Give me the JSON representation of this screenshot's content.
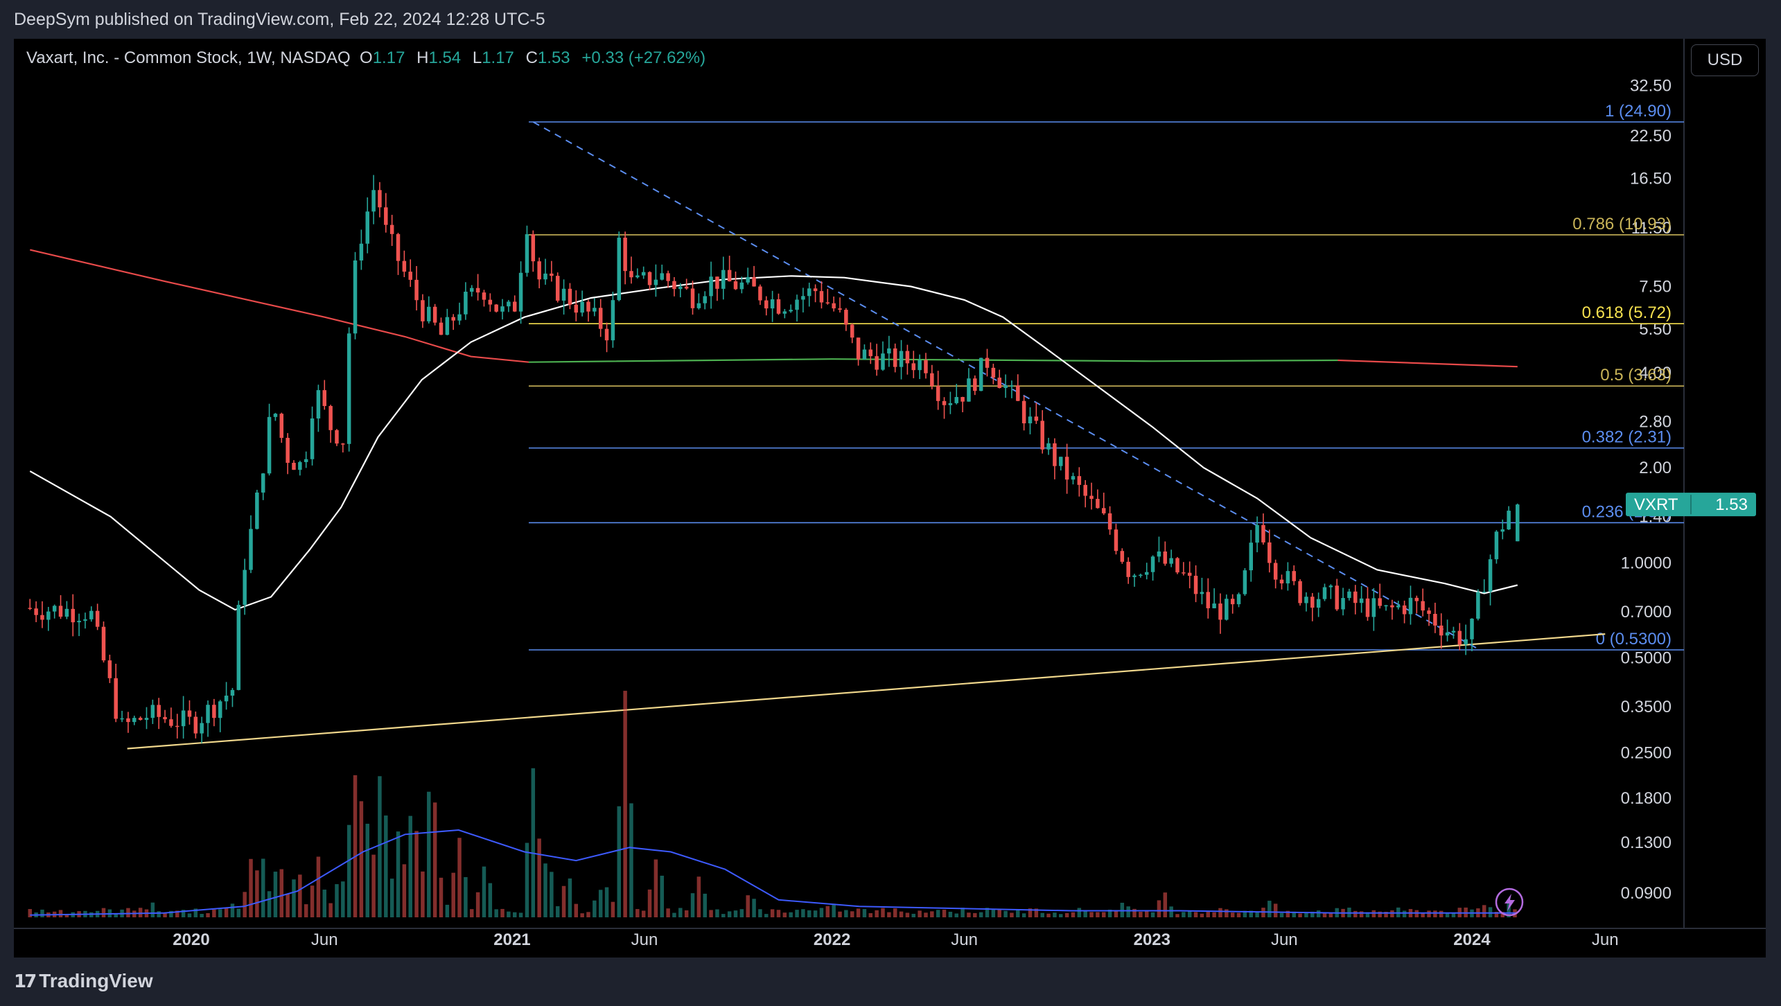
{
  "header": {
    "published": "DeepSym published on TradingView.com, Feb 22, 2024 12:28 UTC-5"
  },
  "legend": {
    "symbol_desc": "Vaxart, Inc. - Common Stock, 1W, NASDAQ",
    "o_label": "O",
    "o_value": "1.17",
    "h_label": "H",
    "h_value": "1.54",
    "l_label": "L",
    "l_value": "1.17",
    "c_label": "C",
    "c_value": "1.53",
    "change": "+0.33 (+27.62%)"
  },
  "currency_button": "USD",
  "brand": "TradingView",
  "price_tag": {
    "symbol": "VXRT",
    "price": "1.53"
  },
  "colors": {
    "up": "#26a69a",
    "down": "#ef5350",
    "fib_blue": "#5b8def",
    "fib_gold": "#c9b458",
    "fib_yellow": "#f5e04e",
    "trend": "#f0d78c",
    "ma_white": "#ffffff",
    "ma_red": "#e84a4a",
    "ma_green": "#4caf50",
    "vol_ma": "#3d5afe"
  },
  "chart_data": {
    "type": "candlestick",
    "title": "Vaxart, Inc. - Common Stock, 1W, NASDAQ",
    "y_scale": "log",
    "y_ticks": [
      "32.50",
      "22.50",
      "16.50",
      "11.50",
      "7.50",
      "5.50",
      "4.00",
      "2.80",
      "2.00",
      "1.40",
      "1.0000",
      "0.7000",
      "0.5000",
      "0.3500",
      "0.2500",
      "0.1800",
      "0.1300",
      "0.0900"
    ],
    "x_ticks": [
      {
        "label": "2020",
        "bold": true,
        "date": "2020-01-01"
      },
      {
        "label": "Jun",
        "bold": false,
        "date": "2020-06-01"
      },
      {
        "label": "2021",
        "bold": true,
        "date": "2021-01-01"
      },
      {
        "label": "Jun",
        "bold": false,
        "date": "2021-06-01"
      },
      {
        "label": "2022",
        "bold": true,
        "date": "2022-01-01"
      },
      {
        "label": "Jun",
        "bold": false,
        "date": "2022-06-01"
      },
      {
        "label": "2023",
        "bold": true,
        "date": "2023-01-01"
      },
      {
        "label": "Jun",
        "bold": false,
        "date": "2023-06-01"
      },
      {
        "label": "2024",
        "bold": true,
        "date": "2024-01-01"
      },
      {
        "label": "Jun",
        "bold": false,
        "date": "2024-06-01"
      }
    ],
    "fib_levels": [
      {
        "label": "1 (24.90)",
        "price": 24.9,
        "color": "fib_blue"
      },
      {
        "label": "0.786 (10.93)",
        "price": 10.93,
        "color": "fib_gold"
      },
      {
        "label": "0.618 (5.72)",
        "price": 5.72,
        "color": "fib_yellow"
      },
      {
        "label": "0.5 (3.63)",
        "price": 3.63,
        "color": "fib_gold"
      },
      {
        "label": "0.382 (2.31)",
        "price": 2.31,
        "color": "fib_blue"
      },
      {
        "label": "0.236 (1.34)",
        "price": 1.34,
        "color": "fib_blue"
      },
      {
        "label": "0 (0.5300)",
        "price": 0.53,
        "color": "fib_blue"
      }
    ],
    "price_path": [
      [
        "2019-07-01",
        0.72
      ],
      [
        "2019-09-15",
        0.7
      ],
      [
        "2019-10-20",
        0.3
      ],
      [
        "2019-11-20",
        0.33
      ],
      [
        "2020-01-10",
        0.31
      ],
      [
        "2020-02-25",
        0.4
      ],
      [
        "2020-03-05",
        0.9
      ],
      [
        "2020-03-20",
        1.4
      ],
      [
        "2020-04-10",
        3.2
      ],
      [
        "2020-04-25",
        2.2
      ],
      [
        "2020-05-15",
        2.0
      ],
      [
        "2020-05-28",
        3.6
      ],
      [
        "2020-06-15",
        2.7
      ],
      [
        "2020-06-30",
        2.45
      ],
      [
        "2020-07-08",
        7.0
      ],
      [
        "2020-07-20",
        11.0
      ],
      [
        "2020-08-05",
        16.0
      ],
      [
        "2020-08-15",
        11.5
      ],
      [
        "2020-09-05",
        8.5
      ],
      [
        "2020-09-25",
        6.5
      ],
      [
        "2020-10-20",
        5.2
      ],
      [
        "2020-11-10",
        6.5
      ],
      [
        "2020-12-05",
        7.5
      ],
      [
        "2020-12-25",
        6.2
      ],
      [
        "2021-01-10",
        6.3
      ],
      [
        "2021-01-25",
        12.0
      ],
      [
        "2021-02-05",
        8.0
      ],
      [
        "2021-03-05",
        7.2
      ],
      [
        "2021-04-10",
        6.0
      ],
      [
        "2021-04-30",
        5.3
      ],
      [
        "2021-05-10",
        10.5
      ],
      [
        "2021-05-25",
        7.5
      ],
      [
        "2021-06-25",
        8.2
      ],
      [
        "2021-08-01",
        7.0
      ],
      [
        "2021-08-25",
        7.9
      ],
      [
        "2021-10-01",
        7.5
      ],
      [
        "2021-11-10",
        6.6
      ],
      [
        "2021-12-20",
        7.3
      ],
      [
        "2022-01-15",
        6.2
      ],
      [
        "2022-02-05",
        4.6
      ],
      [
        "2022-03-15",
        4.4
      ],
      [
        "2022-04-25",
        4.3
      ],
      [
        "2022-05-15",
        3.3
      ],
      [
        "2022-06-10",
        3.5
      ],
      [
        "2022-07-05",
        4.4
      ],
      [
        "2022-07-25",
        3.6
      ],
      [
        "2022-08-25",
        2.7
      ],
      [
        "2022-09-20",
        2.1
      ],
      [
        "2022-10-25",
        1.6
      ],
      [
        "2022-11-20",
        1.3
      ],
      [
        "2022-12-15",
        0.92
      ],
      [
        "2023-01-10",
        1.05
      ],
      [
        "2023-02-15",
        0.9
      ],
      [
        "2023-03-15",
        0.72
      ],
      [
        "2023-04-15",
        0.7
      ],
      [
        "2023-05-10",
        1.4
      ],
      [
        "2023-05-25",
        1.0
      ],
      [
        "2023-06-25",
        0.8
      ],
      [
        "2023-08-01",
        0.78
      ],
      [
        "2023-09-01",
        0.74
      ],
      [
        "2023-10-01",
        0.7
      ],
      [
        "2023-11-01",
        0.75
      ],
      [
        "2023-12-15",
        0.6
      ],
      [
        "2024-01-05",
        0.57
      ],
      [
        "2024-01-20",
        0.85
      ],
      [
        "2024-02-05",
        1.2
      ],
      [
        "2024-02-22",
        1.53
      ]
    ],
    "ma_white": [
      [
        "2019-07-01",
        1.95
      ],
      [
        "2019-10-01",
        1.4
      ],
      [
        "2020-01-10",
        0.82
      ],
      [
        "2020-02-20",
        0.71
      ],
      [
        "2020-04-01",
        0.78
      ],
      [
        "2020-05-15",
        1.1
      ],
      [
        "2020-06-20",
        1.5
      ],
      [
        "2020-08-01",
        2.5
      ],
      [
        "2020-09-20",
        3.8
      ],
      [
        "2020-11-15",
        5.0
      ],
      [
        "2021-01-15",
        6.0
      ],
      [
        "2021-04-01",
        6.9
      ],
      [
        "2021-06-15",
        7.4
      ],
      [
        "2021-09-01",
        7.9
      ],
      [
        "2021-11-15",
        8.1
      ],
      [
        "2022-01-15",
        8.0
      ],
      [
        "2022-04-01",
        7.5
      ],
      [
        "2022-06-01",
        6.8
      ],
      [
        "2022-07-15",
        6.0
      ],
      [
        "2022-09-01",
        4.8
      ],
      [
        "2022-11-01",
        3.6
      ],
      [
        "2023-01-01",
        2.7
      ],
      [
        "2023-03-01",
        2.0
      ],
      [
        "2023-05-01",
        1.6
      ],
      [
        "2023-07-01",
        1.2
      ],
      [
        "2023-09-15",
        0.95
      ],
      [
        "2023-12-01",
        0.86
      ],
      [
        "2024-01-15",
        0.8
      ],
      [
        "2024-02-22",
        0.85
      ]
    ],
    "ma_red": [
      [
        "2019-07-01",
        9.8
      ],
      [
        "2019-12-01",
        7.8
      ],
      [
        "2020-06-01",
        6.0
      ],
      [
        "2020-09-01",
        5.2
      ],
      [
        "2020-11-15",
        4.5
      ],
      [
        "2021-01-20",
        4.32
      ]
    ],
    "ma_green": [
      [
        "2021-01-20",
        4.32
      ],
      [
        "2022-01-01",
        4.42
      ],
      [
        "2023-01-01",
        4.35
      ],
      [
        "2023-08-01",
        4.38
      ]
    ],
    "ma_red_2": [
      [
        "2023-08-01",
        4.38
      ],
      [
        "2024-02-22",
        4.18
      ]
    ],
    "trendline_solid": [
      [
        "2019-10-20",
        0.258
      ],
      [
        "2024-06-01",
        0.595
      ]
    ],
    "trendline_dashed": [
      [
        "2021-01-25",
        24.9
      ],
      [
        "2024-01-10",
        0.53
      ]
    ],
    "volume_bars": [
      [
        "2019-11-15",
        4
      ],
      [
        "2020-02-15",
        3
      ],
      [
        "2020-03-10",
        25
      ],
      [
        "2020-03-20",
        30
      ],
      [
        "2020-04-10",
        28
      ],
      [
        "2020-05-01",
        20
      ],
      [
        "2020-05-25",
        25
      ],
      [
        "2020-06-20",
        18
      ],
      [
        "2020-07-05",
        70
      ],
      [
        "2020-07-15",
        62
      ],
      [
        "2020-08-05",
        72
      ],
      [
        "2020-08-25",
        40
      ],
      [
        "2020-09-10",
        55
      ],
      [
        "2020-10-01",
        72
      ],
      [
        "2020-11-01",
        35
      ],
      [
        "2020-12-01",
        22
      ],
      [
        "2021-01-25",
        65
      ],
      [
        "2021-02-10",
        28
      ],
      [
        "2021-03-05",
        20
      ],
      [
        "2021-04-15",
        15
      ],
      [
        "2021-05-10",
        100
      ],
      [
        "2021-06-15",
        28
      ],
      [
        "2021-08-01",
        18
      ],
      [
        "2021-10-01",
        9
      ],
      [
        "2022-01-01",
        4
      ],
      [
        "2022-06-01",
        3
      ],
      [
        "2022-12-01",
        5
      ],
      [
        "2023-01-15",
        8
      ],
      [
        "2023-05-15",
        6
      ],
      [
        "2024-01-20",
        5
      ],
      [
        "2024-02-15",
        5
      ]
    ],
    "volume_ma": [
      [
        "2019-07-01",
        1
      ],
      [
        "2019-12-01",
        2
      ],
      [
        "2020-03-01",
        5
      ],
      [
        "2020-05-01",
        12
      ],
      [
        "2020-07-15",
        30
      ],
      [
        "2020-09-01",
        38
      ],
      [
        "2020-11-01",
        40
      ],
      [
        "2021-01-15",
        30
      ],
      [
        "2021-03-15",
        26
      ],
      [
        "2021-05-15",
        32
      ],
      [
        "2021-07-01",
        30
      ],
      [
        "2021-09-01",
        22
      ],
      [
        "2021-11-01",
        8
      ],
      [
        "2022-02-01",
        5
      ],
      [
        "2022-06-01",
        4
      ],
      [
        "2022-10-01",
        3
      ],
      [
        "2023-02-01",
        3
      ],
      [
        "2023-08-01",
        2
      ],
      [
        "2024-02-22",
        2
      ]
    ],
    "volume_max_label": "",
    "last_candle": {
      "date": "2024-02-22",
      "open": 1.17,
      "high": 1.54,
      "low": 1.17,
      "close": 1.53
    }
  }
}
